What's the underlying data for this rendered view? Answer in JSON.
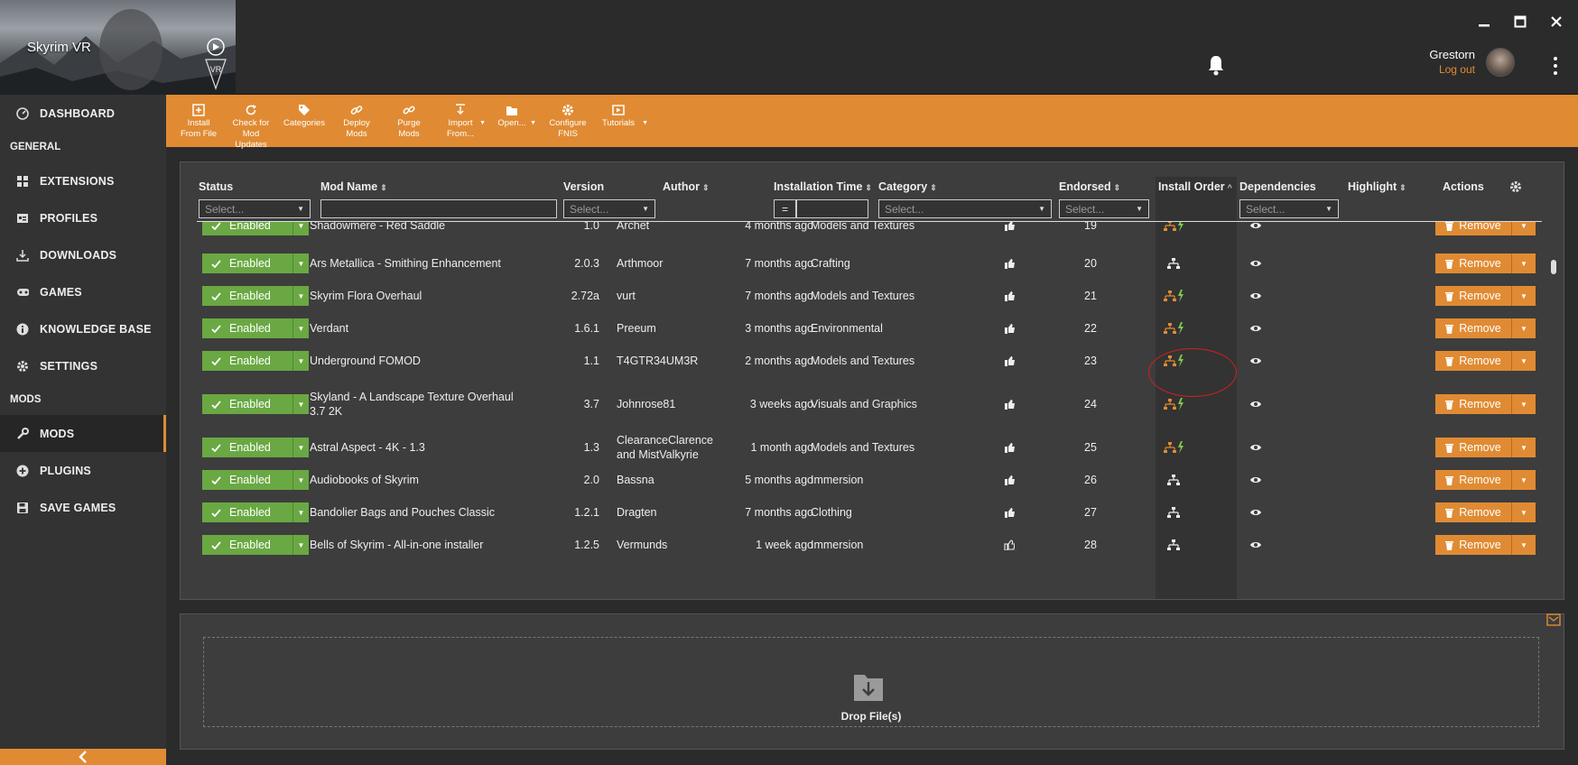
{
  "window": {
    "game_title": "Skyrim VR",
    "badge": "VR",
    "controls": [
      "minimize-icon",
      "maximize-icon",
      "close-icon"
    ]
  },
  "user": {
    "name": "Grestorn",
    "logout": "Log out"
  },
  "sidebar": {
    "items": [
      {
        "label": "DASHBOARD",
        "icon": "dashboard-icon"
      },
      {
        "section": "GENERAL"
      },
      {
        "label": "EXTENSIONS",
        "icon": "extensions-icon"
      },
      {
        "label": "PROFILES",
        "icon": "profiles-icon"
      },
      {
        "label": "DOWNLOADS",
        "icon": "download-icon"
      },
      {
        "label": "GAMES",
        "icon": "gamepad-icon"
      },
      {
        "label": "KNOWLEDGE BASE",
        "icon": "info-icon"
      },
      {
        "label": "SETTINGS",
        "icon": "gear-icon"
      },
      {
        "section": "MODS"
      },
      {
        "label": "MODS",
        "icon": "wrench-icon",
        "active": true
      },
      {
        "label": "PLUGINS",
        "icon": "plus-circle-icon"
      },
      {
        "label": "SAVE GAMES",
        "icon": "save-icon"
      }
    ]
  },
  "toolbar": {
    "buttons": [
      {
        "label": "Install From File",
        "icon": "install-file-icon"
      },
      {
        "label": "Check for Mod Updates",
        "icon": "refresh-icon"
      },
      {
        "label": "Categories",
        "icon": "tag-icon"
      },
      {
        "label": "Deploy Mods",
        "icon": "link-icon"
      },
      {
        "label": "Purge Mods",
        "icon": "unlink-icon"
      },
      {
        "label": "Import From...",
        "icon": "import-icon",
        "dropdown": true
      },
      {
        "label": "Open...",
        "icon": "folder-icon",
        "dropdown": true
      },
      {
        "label": "Configure FNIS",
        "icon": "gear-icon"
      },
      {
        "label": "Tutorials",
        "icon": "video-icon",
        "dropdown": true
      }
    ]
  },
  "table": {
    "columns": {
      "status": "Status",
      "name": "Mod Name",
      "version": "Version",
      "author": "Author",
      "install_time": "Installation Time",
      "category": "Category",
      "endorsed": "Endorsed",
      "install_order": "Install Order",
      "dependencies": "Dependencies",
      "highlight": "Highlight",
      "actions": "Actions"
    },
    "filters": {
      "status": "Select...",
      "version": "Select...",
      "install_time_op": "=",
      "category": "Select...",
      "endorsed": "Select...",
      "dependencies": "Select..."
    },
    "enabled_label": "Enabled",
    "remove_label": "Remove",
    "rows": [
      {
        "name": "Shadowmere - Red Saddle",
        "version": "1.0",
        "author": "Archet",
        "time": "4 months ago",
        "category": "Models and Textures",
        "order": "19",
        "dep": "conflict",
        "endorsed": true
      },
      {
        "name": "Ars Metallica - Smithing Enhancement",
        "version": "2.0.3",
        "author": "Arthmoor",
        "time": "7 months ago",
        "category": "Crafting",
        "order": "20",
        "dep": "plain",
        "endorsed": true
      },
      {
        "name": "Skyrim Flora Overhaul",
        "version": "2.72a",
        "author": "vurt",
        "time": "7 months ago",
        "category": "Models and Textures",
        "order": "21",
        "dep": "conflict",
        "endorsed": true
      },
      {
        "name": "Verdant",
        "version": "1.6.1",
        "author": "Preeum",
        "time": "3 months ago",
        "category": "Environmental",
        "order": "22",
        "dep": "conflict",
        "endorsed": true
      },
      {
        "name": "Underground FOMOD",
        "version": "1.1",
        "author": "T4GTR34UM3R",
        "time": "2 months ago",
        "category": "Models and Textures",
        "order": "23",
        "dep": "conflict",
        "endorsed": true
      },
      {
        "name": "Skyland - A Landscape Texture Overhaul 3.7 2K",
        "version": "3.7",
        "author": "Johnrose81",
        "time": "3 weeks ago",
        "category": "Visuals and Graphics",
        "order": "24",
        "dep": "conflict",
        "endorsed": true
      },
      {
        "name": "Astral Aspect - 4K - 1.3",
        "version": "1.3",
        "author": "ClearanceClarence and MistValkyrie",
        "time": "1 month ago",
        "category": "Models and Textures",
        "order": "25",
        "dep": "conflict",
        "endorsed": true
      },
      {
        "name": "Audiobooks of Skyrim",
        "version": "2.0",
        "author": "Bassna",
        "time": "5 months ago",
        "category": "Immersion",
        "order": "26",
        "dep": "plain",
        "endorsed": true
      },
      {
        "name": "Bandolier Bags and Pouches Classic",
        "version": "1.2.1",
        "author": "Dragten",
        "time": "7 months ago",
        "category": "Clothing",
        "order": "27",
        "dep": "plain",
        "endorsed": true
      },
      {
        "name": "Bells of Skyrim - All-in-one installer",
        "version": "1.2.5",
        "author": "Vermunds",
        "time": "1 week ago",
        "category": "Immersion",
        "order": "28",
        "dep": "plain",
        "endorsed": false
      }
    ]
  },
  "dropzone": {
    "label": "Drop File(s)"
  },
  "colors": {
    "accent": "#e08b33",
    "enabled": "#6aa843",
    "highlight_circle": "#d02020"
  }
}
